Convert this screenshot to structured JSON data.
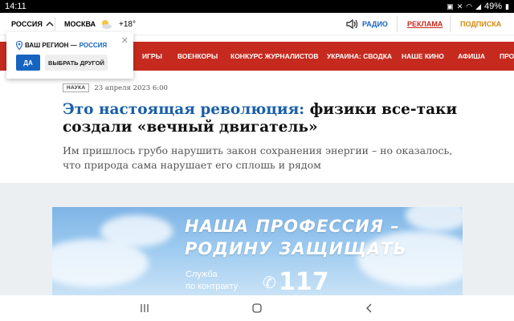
{
  "status_bar": {
    "time": "14:11",
    "battery": "49%"
  },
  "topbar": {
    "region": "РОССИЯ",
    "city": "МОСКВА",
    "temperature": "+18°",
    "radio": "РАДИО",
    "ads": "РЕКЛАМА",
    "subscribe": "ПОДПИСКА"
  },
  "nav": {
    "items": [
      "ИГРЫ",
      "ВОЕНКОРЫ",
      "КОНКУРС ЖУРНАЛИСТОВ",
      "УКРАИНА: СВОДКА",
      "НАШЕ КИНО",
      "АФИША",
      "ПРО"
    ]
  },
  "region_popup": {
    "prefix": "ВАШ РЕГИОН —",
    "region": "РОССИЯ",
    "yes_label": "ДА",
    "other_label": "ВЫБРАТЬ ДРУГОЙ"
  },
  "article": {
    "tag": "НАУКА",
    "date": "23 апреля 2023 6:00",
    "headline_accent": "Это настоящая революция:",
    "headline_rest": " физики все-таки создали «вечный двигатель»",
    "lead": "Им пришлось грубо нарушить закон сохранения энергии – но оказалось, что природа сама нарушает его сплошь и рядом"
  },
  "ad": {
    "line1": "НАША ПРОФЕССИЯ –",
    "line2": "РОДИНУ ЗАЩИЩАТЬ",
    "small1": "Служба",
    "small2": "по контракту",
    "number": "117"
  },
  "colors": {
    "nav_bg": "#c62a1f",
    "accent_blue": "#1a5fa8",
    "button_blue": "#1565c0"
  }
}
